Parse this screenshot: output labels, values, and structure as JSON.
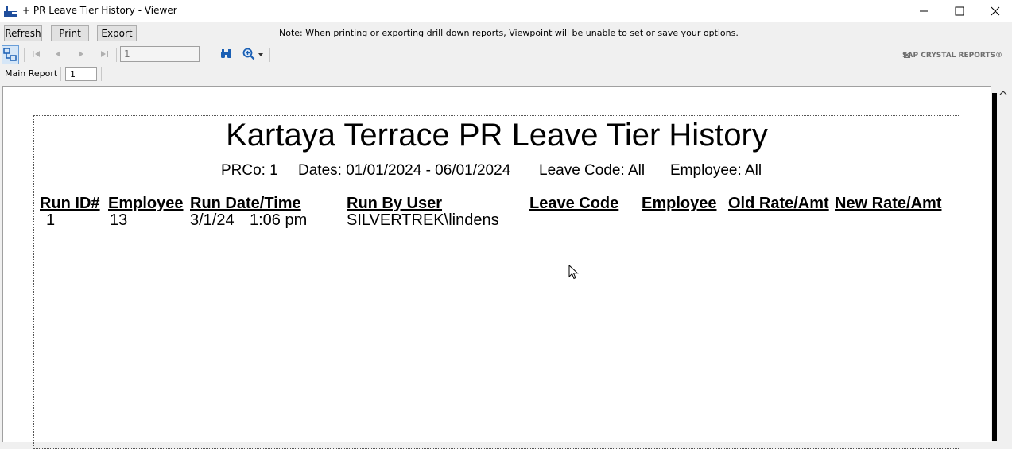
{
  "window": {
    "title": "+ PR Leave Tier History - Viewer",
    "controls": {
      "minimize": "minimize-icon",
      "maximize": "maximize-icon",
      "close": "close-icon"
    }
  },
  "toolbar": {
    "refresh_label": "Refresh",
    "print_label": "Print",
    "export_label": "Export",
    "note": "Note: When printing or exporting drill down reports, Viewpoint will be unable to set or save your options."
  },
  "nav": {
    "page_value": "1",
    "brand": "SAP CRYSTAL REPORTS®"
  },
  "tab": {
    "label": "Main Report",
    "page": "1"
  },
  "report": {
    "title": "Kartaya Terrace PR Leave Tier History",
    "params": {
      "prco": "PRCo: 1",
      "dates": "Dates: 01/01/2024 - 06/01/2024",
      "leave_code": "Leave Code: All",
      "employee": "Employee: All"
    },
    "columns": {
      "run_id": "Run ID#",
      "employee": "Employee",
      "run_datetime": "Run Date/Time",
      "run_by": "Run By User",
      "leave_code": "Leave Code",
      "employee2": "Employee",
      "old_rate": "Old Rate/Amt",
      "new_rate": "New Rate/Amt"
    },
    "rows": [
      {
        "run_id": "1",
        "employee": "13",
        "run_date": "3/1/24",
        "run_time": "1:06 pm",
        "run_by": "SILVERTREK\\lindens"
      }
    ]
  },
  "colors": {
    "window_bg": "#f0f0f0",
    "report_bg": "#ffffff",
    "nav_icon_blue": "#1a5fb4"
  }
}
